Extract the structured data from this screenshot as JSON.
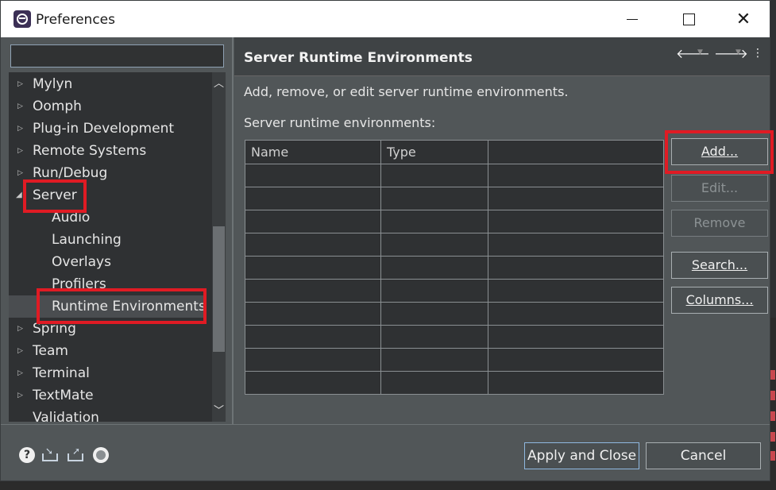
{
  "window": {
    "title": "Preferences"
  },
  "filter": {
    "value": "",
    "placeholder": ""
  },
  "tree": {
    "items": [
      {
        "label": "Mylyn",
        "level": 0,
        "expander": "collapsed"
      },
      {
        "label": "Oomph",
        "level": 0,
        "expander": "collapsed"
      },
      {
        "label": "Plug-in Development",
        "level": 0,
        "expander": "collapsed"
      },
      {
        "label": "Remote Systems",
        "level": 0,
        "expander": "collapsed"
      },
      {
        "label": "Run/Debug",
        "level": 0,
        "expander": "collapsed"
      },
      {
        "label": "Server",
        "level": 0,
        "expander": "expanded"
      },
      {
        "label": "Audio",
        "level": 1
      },
      {
        "label": "Launching",
        "level": 1
      },
      {
        "label": "Overlays",
        "level": 1
      },
      {
        "label": "Profilers",
        "level": 1
      },
      {
        "label": "Runtime Environments",
        "level": 1,
        "selected": true
      },
      {
        "label": "Spring",
        "level": 0,
        "expander": "collapsed"
      },
      {
        "label": "Team",
        "level": 0,
        "expander": "collapsed"
      },
      {
        "label": "Terminal",
        "level": 0,
        "expander": "collapsed"
      },
      {
        "label": "TextMate",
        "level": 0,
        "expander": "collapsed"
      },
      {
        "label": "Validation",
        "level": 0
      }
    ]
  },
  "page": {
    "title": "Server Runtime Environments",
    "description": "Add, remove, or edit server runtime environments.",
    "list_label": "Server runtime environments:",
    "table": {
      "columns": [
        "Name",
        "Type",
        ""
      ],
      "rows": []
    }
  },
  "buttons": {
    "add": "Add...",
    "edit": "Edit...",
    "remove": "Remove",
    "search": "Search...",
    "columns": "Columns..."
  },
  "footer": {
    "apply_close": "Apply and Close",
    "cancel": "Cancel",
    "help_glyph": "?"
  },
  "colors": {
    "highlight": "#e01b24",
    "accent_border": "#8fb8e0"
  }
}
